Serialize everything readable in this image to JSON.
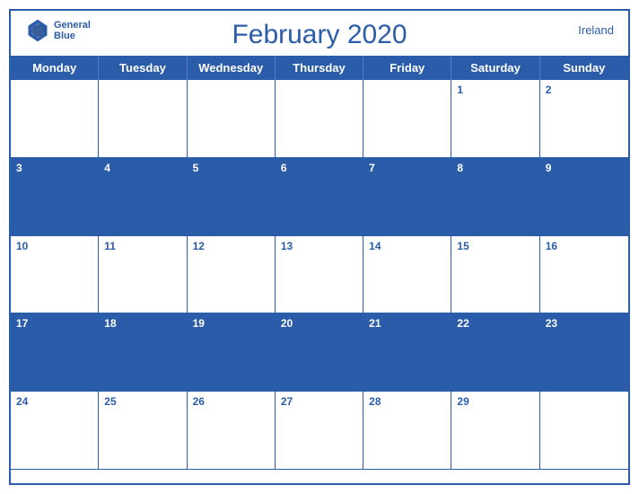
{
  "header": {
    "title": "February 2020",
    "country": "Ireland",
    "logo_general": "General",
    "logo_blue": "Blue"
  },
  "days": [
    "Monday",
    "Tuesday",
    "Wednesday",
    "Thursday",
    "Friday",
    "Saturday",
    "Sunday"
  ],
  "weeks": [
    [
      null,
      null,
      null,
      null,
      null,
      1,
      2
    ],
    [
      3,
      4,
      5,
      6,
      7,
      8,
      9
    ],
    [
      10,
      11,
      12,
      13,
      14,
      15,
      16
    ],
    [
      17,
      18,
      19,
      20,
      21,
      22,
      23
    ],
    [
      24,
      25,
      26,
      27,
      28,
      29,
      null
    ]
  ]
}
